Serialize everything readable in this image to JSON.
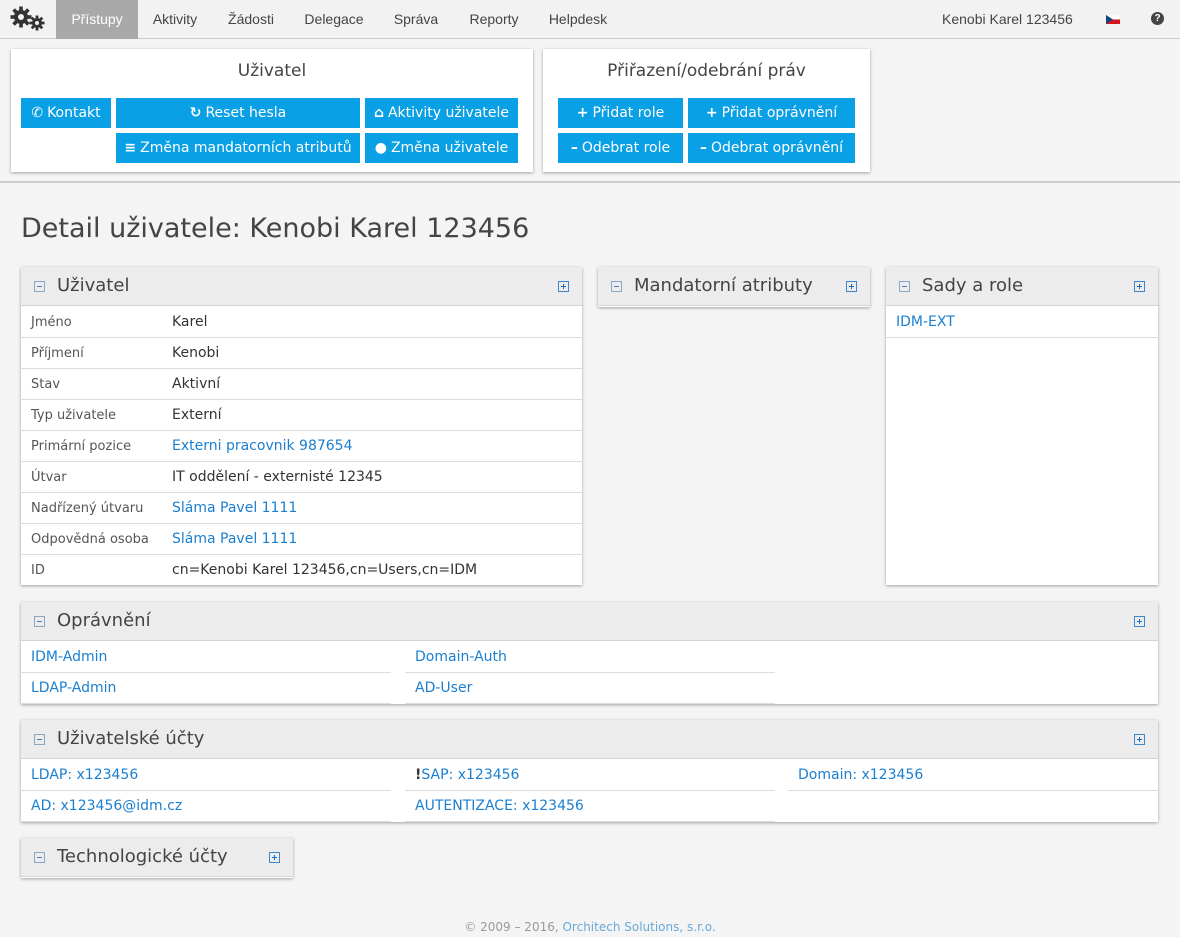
{
  "nav": {
    "items": [
      {
        "label": "Přístupy",
        "active": true
      },
      {
        "label": "Aktivity"
      },
      {
        "label": "Žádosti"
      },
      {
        "label": "Delegace"
      },
      {
        "label": "Správa"
      },
      {
        "label": "Reporty"
      },
      {
        "label": "Helpdesk"
      }
    ],
    "user": "Kenobi Karel 123456",
    "language_icon": "czech-flag-icon",
    "help_icon": "question-circle-icon"
  },
  "user_panel": {
    "title": "Uživatel",
    "buttons": {
      "contact": "Kontakt",
      "reset_password": "Reset hesla",
      "user_activities": "Aktivity uživatele",
      "change_mandatory": "Změna mandatorních atributů",
      "change_user": "Změna uživatele"
    }
  },
  "rights_panel": {
    "title": "Přiřazení/odebrání práv",
    "buttons": {
      "add_role": "Přidat role",
      "add_permission": "Přidat oprávnění",
      "remove_role": "Odebrat role",
      "remove_permission": "Odebrat oprávnění"
    }
  },
  "page_title": "Detail uživatele: Kenobi Karel 123456",
  "user_box": {
    "title": "Uživatel",
    "rows": [
      {
        "label": "Jméno",
        "value": "Karel"
      },
      {
        "label": "Příjmení",
        "value": "Kenobi"
      },
      {
        "label": "Stav",
        "value": "Aktivní"
      },
      {
        "label": "Typ uživatele",
        "value": "Externí"
      },
      {
        "label": "Primární pozice",
        "value": "Externi pracovnik 987654",
        "link": true
      },
      {
        "label": "Útvar",
        "value": "IT oddělení - externisté 12345"
      },
      {
        "label": "Nadřízený útvaru",
        "value": "Sláma Pavel 1111",
        "link": true
      },
      {
        "label": "Odpovědná osoba",
        "value": "Sláma Pavel 1111",
        "link": true
      },
      {
        "label": "ID",
        "value": "cn=Kenobi Karel 123456,cn=Users,cn=IDM"
      }
    ]
  },
  "mandatory_box": {
    "title": "Mandatorní atributy"
  },
  "roles_box": {
    "title": "Sady a role",
    "items": [
      "IDM-EXT"
    ]
  },
  "permissions_box": {
    "title": "Oprávnění",
    "items": [
      "IDM-Admin",
      "Domain-Auth",
      "LDAP-Admin",
      "AD-User"
    ]
  },
  "accounts_box": {
    "title": "Uživatelské účty",
    "items": [
      "LDAP: x123456",
      "SAP: x123456",
      "Domain: x123456",
      "AD: x123456@idm.cz",
      "AUTENTIZACE: x123456"
    ],
    "warning_mark": "!"
  },
  "tech_box": {
    "title": "Technologické účty"
  },
  "footer": {
    "text": "© 2009 – 2016, ",
    "company": "Orchitech Solutions, s.r.o."
  }
}
